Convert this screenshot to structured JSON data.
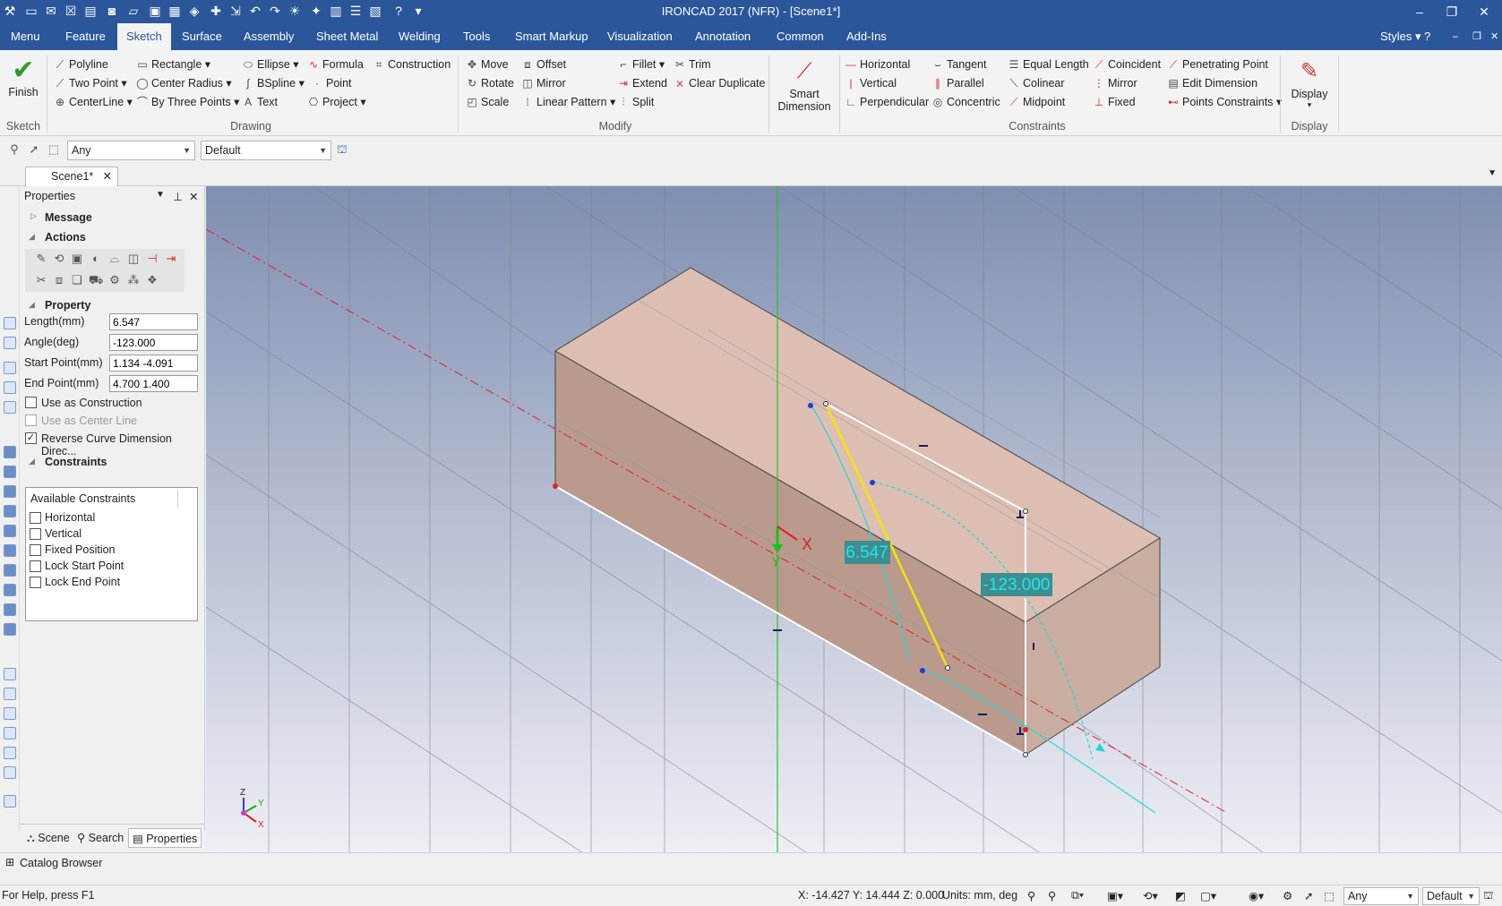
{
  "window": {
    "title": "IRONCAD 2017 (NFR) - [Scene1*]",
    "min": "–",
    "max": "❐",
    "close": "✕"
  },
  "menu": {
    "tabs": [
      "Menu",
      "Feature",
      "Sketch",
      "Surface",
      "Assembly",
      "Sheet Metal",
      "Welding",
      "Tools",
      "Smart Markup",
      "Visualization",
      "Annotation",
      "Common",
      "Add-Ins"
    ],
    "right": {
      "styles": "Styles",
      "help": "?"
    }
  },
  "ribbon": {
    "finish": "Finish",
    "drawing": {
      "polyline": "Polyline",
      "rectangle": "Rectangle",
      "ellipse": "Ellipse",
      "formula": "Formula",
      "construction": "Construction",
      "two_point": "Two Point",
      "center_radius": "Center Radius",
      "bspline": "BSpline",
      "point": "Point",
      "centerline": "CenterLine",
      "by_three_points": "By Three Points",
      "text": "Text",
      "project": "Project"
    },
    "modify": {
      "move": "Move",
      "offset": "Offset",
      "fillet": "Fillet",
      "trim": "Trim",
      "rotate": "Rotate",
      "mirror": "Mirror",
      "extend": "Extend",
      "clear_duplicate": "Clear Duplicate",
      "scale": "Scale",
      "linear_pattern": "Linear Pattern",
      "split": "Split"
    },
    "smart_dimension": "Smart Dimension",
    "constraints": {
      "horizontal": "Horizontal",
      "tangent": "Tangent",
      "equal_length": "Equal Length",
      "coincident": "Coincident",
      "penetrating_point": "Penetrating Point",
      "vertical": "Vertical",
      "parallel": "Parallel",
      "colinear": "Colinear",
      "mirror": "Mirror",
      "edit_dimension": "Edit Dimension",
      "perpendicular": "Perpendicular",
      "concentric": "Concentric",
      "midpoint": "Midpoint",
      "fixed": "Fixed",
      "points_constraints": "Points Constraints"
    },
    "display": "Display",
    "groups": {
      "sketch": "Sketch",
      "drawing": "Drawing",
      "modify": "Modify",
      "constraints": "Constraints",
      "display": "Display"
    }
  },
  "selection": {
    "filter": "Any",
    "style": "Default"
  },
  "doc_tab": "Scene1*",
  "properties": {
    "title": "Properties",
    "message": "Message",
    "actions": "Actions",
    "property": "Property",
    "fields": [
      {
        "label": "Length(mm)",
        "value": "6.547"
      },
      {
        "label": "Angle(deg)",
        "value": "-123.000"
      },
      {
        "label": "Start Point(mm)",
        "value": "1.134 -4.091"
      },
      {
        "label": "End Point(mm)",
        "value": "4.700 1.400"
      }
    ],
    "use_construction": "Use as Construction",
    "use_center_line": "Use as Center Line",
    "reverse_dim": "Reverse Curve Dimension Direc...",
    "constraints_title": "Constraints",
    "available": "Available Constraints",
    "constraint_items": [
      "Horizontal",
      "Vertical",
      "Fixed Position",
      "Lock Start Point",
      "Lock End Point"
    ],
    "bottom_tabs": [
      "Scene",
      "Search",
      "Properties"
    ]
  },
  "viewport": {
    "dim_length": "6.547",
    "dim_angle": "-123.000",
    "axis_x": "X",
    "axis_y": "Y",
    "triad": {
      "z": "Z",
      "y": "Y",
      "x": "X"
    }
  },
  "catalog": "Catalog Browser",
  "status": {
    "help": "For Help, press F1",
    "coords": "X: -14.427 Y: 14.444 Z: 0.000",
    "units": "Units: mm, deg",
    "filter": "Any",
    "style": "Default"
  }
}
